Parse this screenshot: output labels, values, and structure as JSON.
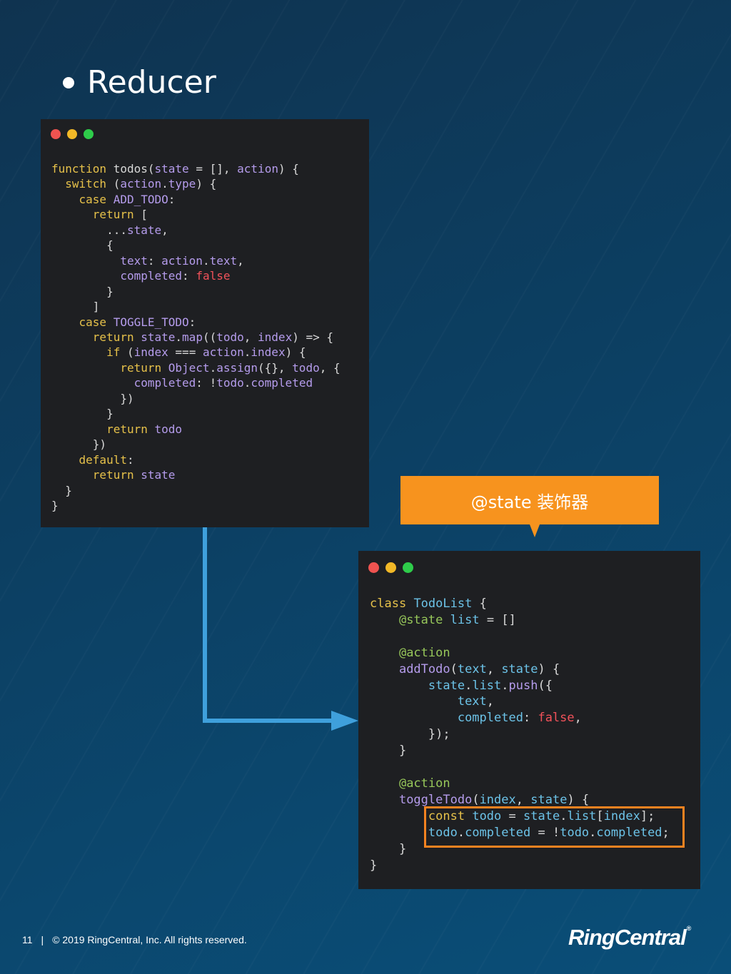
{
  "slide": {
    "title": "Reducer",
    "callout": "@state 装饰器",
    "page_number": "11",
    "separator": "|",
    "copyright": "© 2019 RingCentral, Inc.  All rights reserved.",
    "logo_text": "RingCentral",
    "logo_mark": "®"
  },
  "colors": {
    "accent_orange": "#f7931e",
    "arrow_blue": "#3fa0dc",
    "code_bg": "#1e1f22"
  },
  "code1": [
    "function todos(state = [], action) {",
    "  switch (action.type) {",
    "    case ADD_TODO:",
    "      return [",
    "        ...state,",
    "        {",
    "          text: action.text,",
    "          completed: false",
    "        }",
    "      ]",
    "    case TOGGLE_TODO:",
    "      return state.map((todo, index) => {",
    "        if (index === action.index) {",
    "          return Object.assign({}, todo, {",
    "            completed: !todo.completed",
    "          })",
    "        }",
    "        return todo",
    "      })",
    "    default:",
    "      return state",
    "  }",
    "}"
  ],
  "code2": [
    "class TodoList {",
    "    @state list = []",
    "",
    "    @action",
    "    addTodo(text, state) {",
    "        state.list.push({",
    "            text,",
    "            completed: false,",
    "        });",
    "    }",
    "",
    "    @action",
    "    toggleTodo(index, state) {",
    "        const todo = state.list[index];",
    "        todo.completed = !todo.completed;",
    "    }",
    "}"
  ]
}
